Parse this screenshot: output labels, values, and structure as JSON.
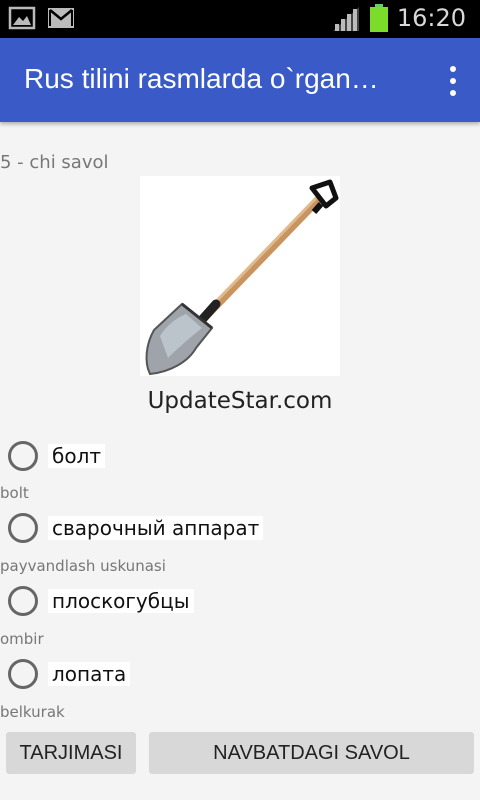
{
  "status_bar": {
    "time": "16:20",
    "icons": [
      "image-icon",
      "gmail-icon",
      "signal-icon",
      "battery-icon"
    ]
  },
  "app_bar": {
    "title": "Rus tilini rasmlarda o`rgan…",
    "menu_icon": "overflow-menu-icon",
    "color": "#3a5bc7"
  },
  "question": {
    "label": "5 - chi savol",
    "image": "shovel",
    "watermark": "UpdateStar.com"
  },
  "options": [
    {
      "label": "болт",
      "translation": "bolt"
    },
    {
      "label": "сварочный аппарат",
      "translation": "payvandlash uskunasi"
    },
    {
      "label": "плоскогубцы",
      "translation": "ombir"
    },
    {
      "label": "лопата",
      "translation": "belkurak"
    }
  ],
  "buttons": {
    "translate": "TARJIMASI",
    "next": "NAVBATDAGI SAVOL"
  }
}
